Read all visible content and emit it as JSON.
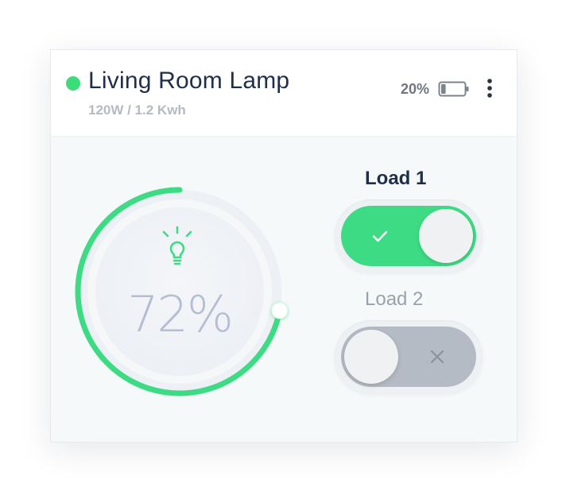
{
  "device": {
    "name": "Living Room Lamp",
    "power_info": "120W / 1.2 Kwh",
    "status_color": "#3ddc7a"
  },
  "battery": {
    "percent_label": "20%",
    "level": 0.2,
    "icon": "battery-low-icon"
  },
  "menu": {
    "icon": "more-vertical-icon"
  },
  "dimmer": {
    "value_label": "72%",
    "level": 0.72,
    "icon": "lightbulb-icon",
    "accent_color": "#3ddc84"
  },
  "loads": [
    {
      "label": "Load 1",
      "on": true,
      "icon": "check-icon"
    },
    {
      "label": "Load 2",
      "on": false,
      "icon": "close-icon"
    }
  ]
}
